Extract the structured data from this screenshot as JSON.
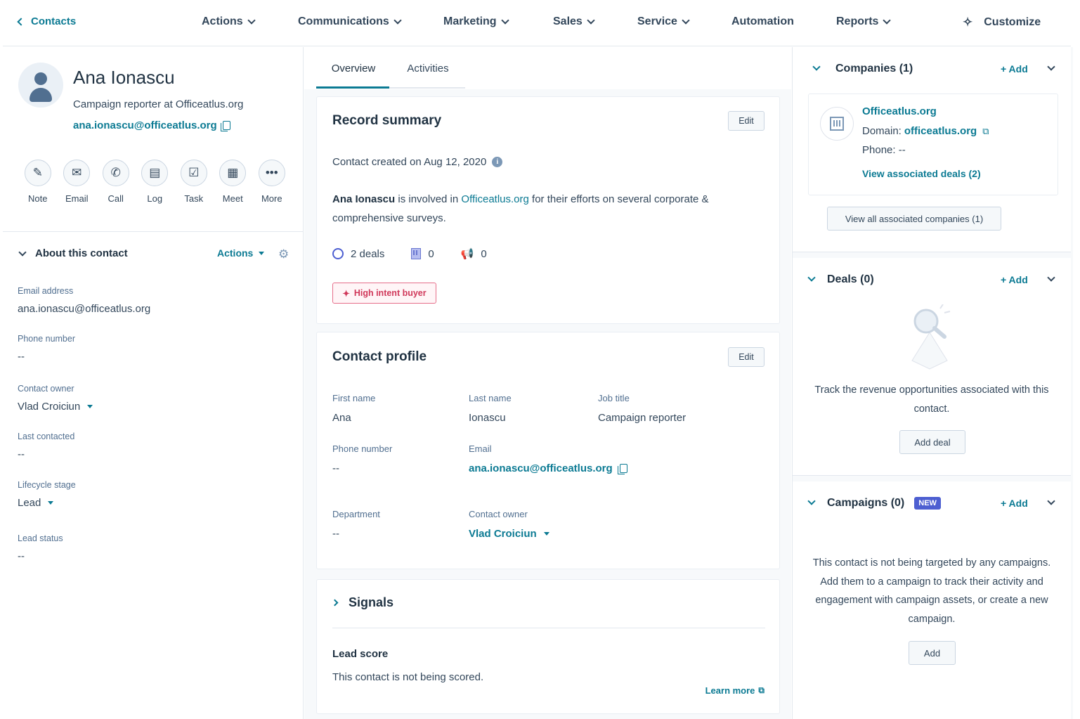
{
  "nav": {
    "back_label": "Contacts",
    "items": [
      "Actions",
      "Communications",
      "Marketing",
      "Sales",
      "Service",
      "Automation",
      "Reports"
    ],
    "customize_label": "Customize"
  },
  "contact": {
    "name": "Ana Ionascu",
    "title": "Campaign reporter at Officeatlus.org",
    "email": "ana.ionascu@officeatlus.org"
  },
  "quick_actions": [
    "Note",
    "Email",
    "Call",
    "Log",
    "Task",
    "Meet",
    "More"
  ],
  "about": {
    "title": "About this contact",
    "actions_label": "Actions",
    "properties": [
      {
        "label": "Email address",
        "value": "ana.ionascu@officeatlus.org"
      },
      {
        "label": "Phone number",
        "value": "--"
      },
      {
        "label": "Contact owner",
        "value": "Vlad Croiciun"
      },
      {
        "label": "Last contacted",
        "value": "--"
      },
      {
        "label": "Lifecycle stage",
        "value": "Lead"
      },
      {
        "label": "Lead status",
        "value": "--"
      }
    ]
  },
  "tabs": [
    "Overview",
    "Activities"
  ],
  "record_summary": {
    "title": "Record summary",
    "edit_label": "Edit",
    "created_text": "Contact created on Aug 12, 2020",
    "summary_name": "Ana Ionascu",
    "summary_mid": " is involved in ",
    "summary_company": "Officeatlus.org",
    "summary_tail": " for their efforts on several corporate & comprehensive surveys.",
    "deals_count": "2 deals",
    "companies_count": "0",
    "campaigns_count": "0",
    "intent_badge": "High intent buyer"
  },
  "contact_profile": {
    "title": "Contact profile",
    "edit_label": "Edit",
    "fields": {
      "first_name": {
        "label": "First name",
        "value": "Ana"
      },
      "last_name": {
        "label": "Last name",
        "value": "Ionascu"
      },
      "job_title": {
        "label": "Job title",
        "value": "Campaign reporter"
      },
      "phone": {
        "label": "Phone number",
        "value": "--"
      },
      "email": {
        "label": "Email",
        "value": "ana.ionascu@officeatlus.org"
      },
      "department": {
        "label": "Department",
        "value": "--"
      },
      "owner": {
        "label": "Contact owner",
        "value": "Vlad Croiciun"
      }
    }
  },
  "signals": {
    "title": "Signals",
    "lead_score_title": "Lead score",
    "lead_score_text": "This contact is not being scored.",
    "learn_more": "Learn more"
  },
  "companies": {
    "title": "Companies (1)",
    "add_label": "+ Add",
    "company_name": "Officeatlus.org",
    "domain_label": "Domain:",
    "domain_value": "officeatlus.org",
    "phone_line": "Phone: --",
    "view_deals": "View associated deals (2)",
    "view_all": "View all associated companies (1)"
  },
  "deals": {
    "title": "Deals (0)",
    "add_label": "+ Add",
    "empty_text": "Track the revenue opportunities associated with this contact.",
    "add_deal_label": "Add deal"
  },
  "campaigns": {
    "title": "Campaigns (0)",
    "new_badge": "NEW",
    "add_label": "+ Add",
    "empty_text": "This contact is not being targeted by any campaigns. Add them to a campaign to track their activity and engagement with campaign assets, or create a new campaign.",
    "add_button_label": "Add"
  },
  "colors": {
    "link": "#0b7a93",
    "text": "#33475b",
    "heading": "#213343",
    "intent": "#d0385a",
    "new_badge": "#4d5fd1"
  }
}
